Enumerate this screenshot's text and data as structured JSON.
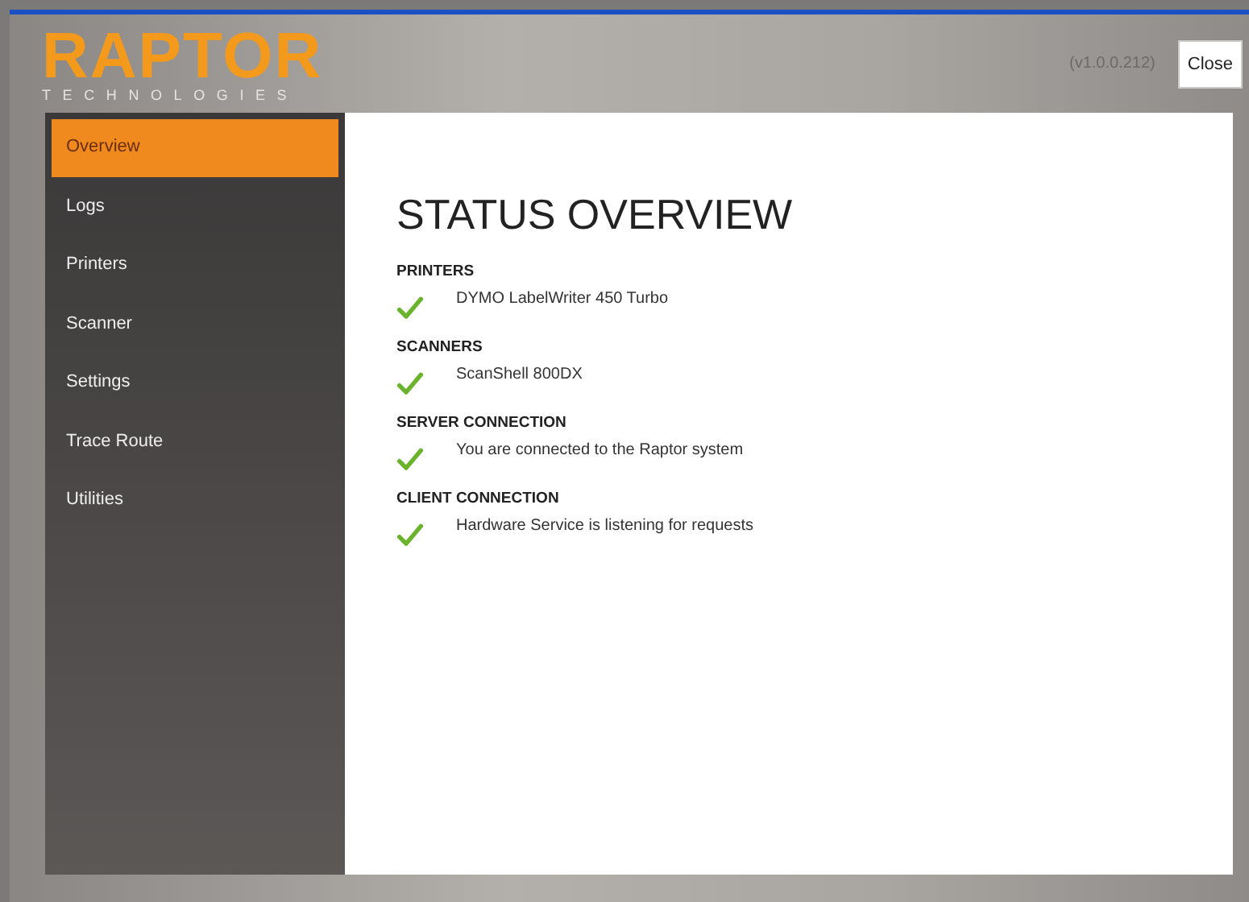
{
  "header": {
    "logo": "RAPTOR",
    "logo_subtitle": "TECHNOLOGIES",
    "version": "(v1.0.0.212)",
    "close_button": "Close"
  },
  "sidebar": {
    "items": [
      {
        "label": "Overview",
        "selected": true
      },
      {
        "label": "Logs",
        "selected": false
      },
      {
        "label": "Printers",
        "selected": false
      },
      {
        "label": "Scanner",
        "selected": false
      },
      {
        "label": "Settings",
        "selected": false
      },
      {
        "label": "Trace Route",
        "selected": false
      },
      {
        "label": "Utilities",
        "selected": false
      }
    ]
  },
  "content": {
    "title": "STATUS OVERVIEW",
    "sections": [
      {
        "heading": "PRINTERS",
        "ok": true,
        "text": "DYMO LabelWriter 450 Turbo"
      },
      {
        "heading": "SCANNERS",
        "ok": true,
        "text": "ScanShell 800DX"
      },
      {
        "heading": "SERVER CONNECTION",
        "ok": true,
        "text": "You are connected to the Raptor system"
      },
      {
        "heading": "CLIENT CONNECTION",
        "ok": true,
        "text": "Hardware Service is listening for requests"
      }
    ]
  }
}
